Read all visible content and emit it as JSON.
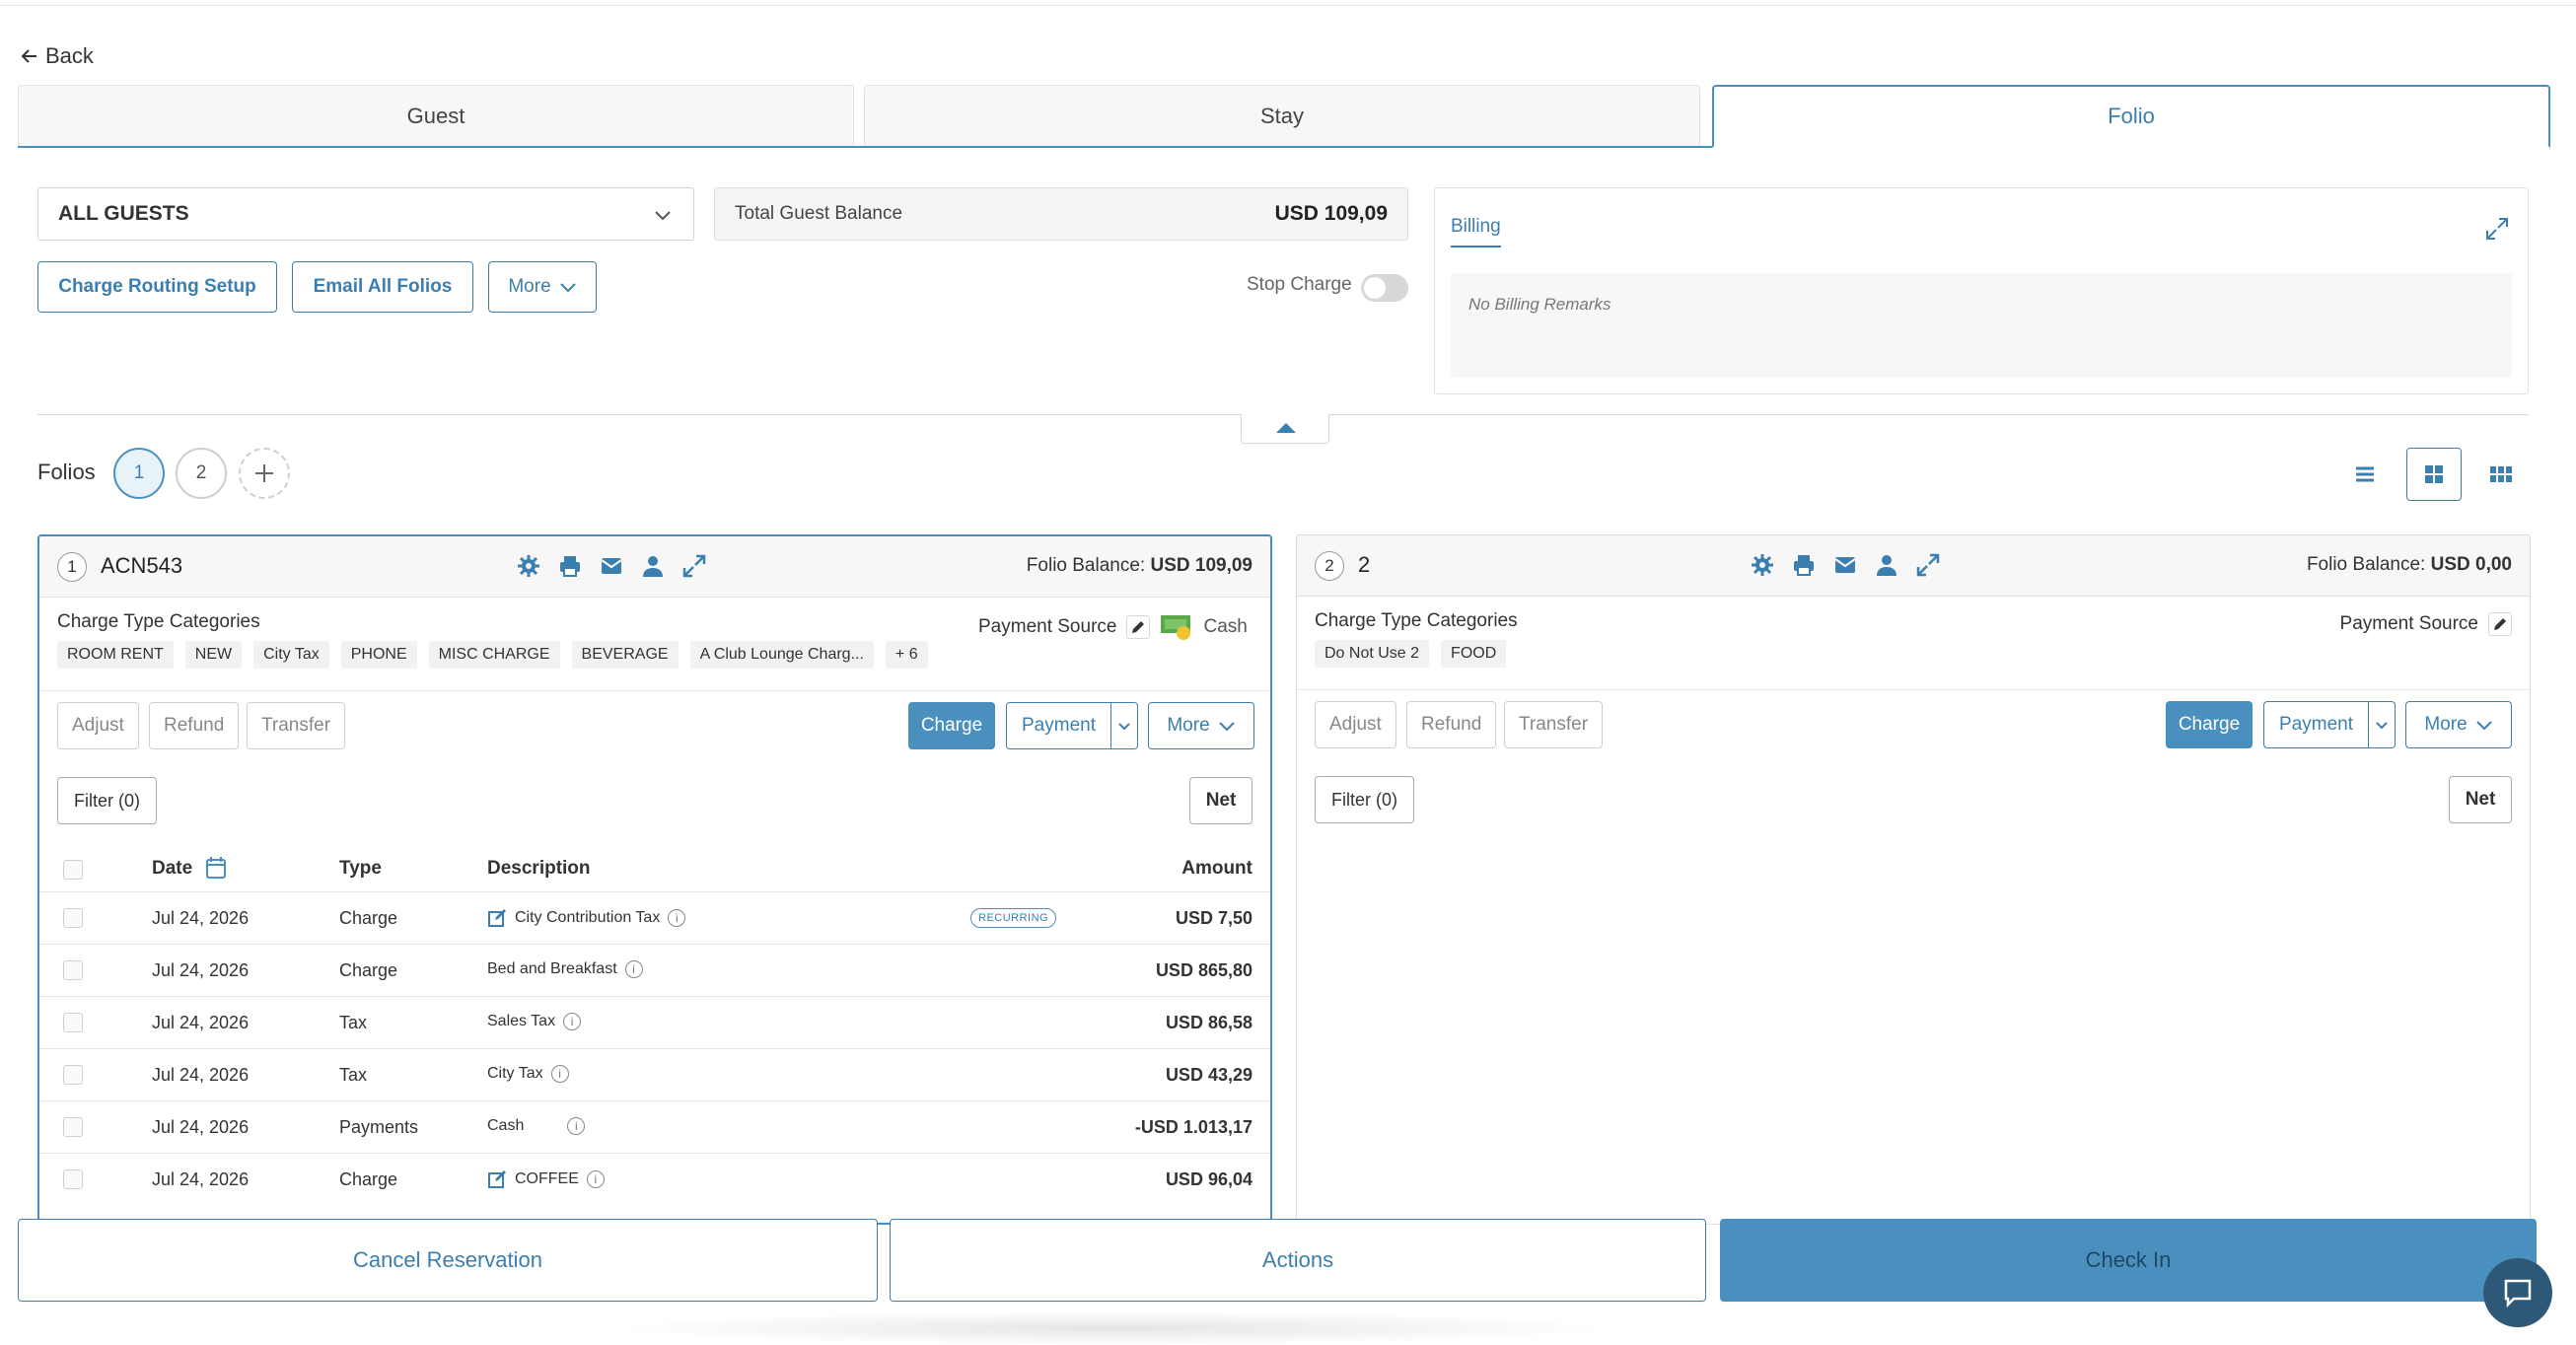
{
  "nav": {
    "back_label": "Back"
  },
  "tabs": [
    {
      "label": "Guest"
    },
    {
      "label": "Stay"
    },
    {
      "label": "Folio"
    }
  ],
  "guest_select": {
    "value": "ALL GUESTS"
  },
  "balance": {
    "label": "Total Guest Balance",
    "value": "USD 109,09"
  },
  "actions": {
    "charge_routing": "Charge Routing Setup",
    "email_all": "Email All Folios",
    "more": "More"
  },
  "stop_charge": {
    "label": "Stop Charge",
    "enabled": false
  },
  "billing": {
    "title": "Billing",
    "remarks": "No Billing Remarks"
  },
  "folios_bar": {
    "label": "Folios",
    "items": [
      "1",
      "2"
    ]
  },
  "folio1": {
    "number": "1",
    "name": "ACN543",
    "balance_label": "Folio Balance:",
    "balance_value": "USD 109,09",
    "ctc_label": "Charge Type Categories",
    "chips": [
      "ROOM RENT",
      "NEW",
      "City Tax",
      "PHONE",
      "MISC CHARGE",
      "BEVERAGE",
      "A Club Lounge Charg...",
      "+ 6"
    ],
    "payment_source_label": "Payment Source",
    "payment_source_value": "Cash",
    "buttons": {
      "adjust": "Adjust",
      "refund": "Refund",
      "transfer": "Transfer",
      "charge": "Charge",
      "payment": "Payment",
      "more": "More",
      "filter": "Filter (0)",
      "net": "Net"
    },
    "columns": {
      "date": "Date",
      "type": "Type",
      "description": "Description",
      "amount": "Amount"
    },
    "rows": [
      {
        "date": "Jul 24, 2026",
        "type": "Charge",
        "description": "City Contribution Tax",
        "badge": "RECURRING",
        "amount": "USD 7,50"
      },
      {
        "date": "Jul 24, 2026",
        "type": "Charge",
        "description": "Bed and Breakfast",
        "amount": "USD 865,80"
      },
      {
        "date": "Jul 24, 2026",
        "type": "Tax",
        "description": "Sales Tax",
        "amount": "USD 86,58"
      },
      {
        "date": "Jul 24, 2026",
        "type": "Tax",
        "description": "City Tax",
        "amount": "USD 43,29"
      },
      {
        "date": "Jul 24, 2026",
        "type": "Payments",
        "description": "Cash",
        "amount": "-USD 1.013,17"
      },
      {
        "date": "Jul 24, 2026",
        "type": "Charge",
        "description": "COFFEE",
        "amount": "USD 96,04"
      }
    ]
  },
  "folio2": {
    "number": "2",
    "name": "2",
    "balance_label": "Folio Balance:",
    "balance_value": "USD 0,00",
    "ctc_label": "Charge Type Categories",
    "chips": [
      "Do Not Use 2",
      "FOOD"
    ],
    "payment_source_label": "Payment Source",
    "buttons": {
      "adjust": "Adjust",
      "refund": "Refund",
      "transfer": "Transfer",
      "charge": "Charge",
      "payment": "Payment",
      "more": "More",
      "filter": "Filter (0)",
      "net": "Net"
    }
  },
  "footer": {
    "cancel": "Cancel Reservation",
    "actions": "Actions",
    "checkin": "Check In"
  },
  "colors": {
    "accent": "#4a90bf",
    "accent_dark": "#3a7fb0"
  }
}
